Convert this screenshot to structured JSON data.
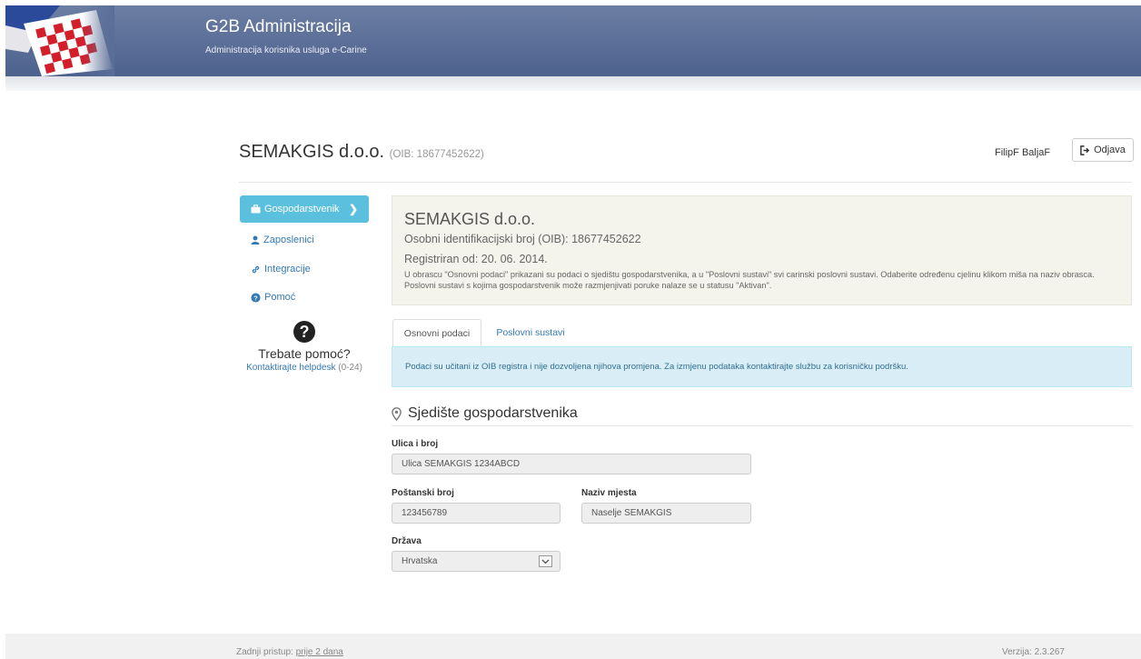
{
  "header": {
    "title": "G2B Administracija",
    "subtitle": "Administracija korisnika usluga e-Carine"
  },
  "topbar": {
    "company_name": "SEMAKGIS d.o.o.",
    "company_oib": "(OIB: 18677452622)",
    "user_name": "FilipF BaljaF",
    "logout_label": "Odjava"
  },
  "sidebar": {
    "items": [
      {
        "label": "Gospodarstvenik",
        "icon": "briefcase-icon",
        "active": true
      },
      {
        "label": "Zaposlenici",
        "icon": "user-icon",
        "active": false
      },
      {
        "label": "Integracije",
        "icon": "link-icon",
        "active": false
      },
      {
        "label": "Pomoć",
        "icon": "question-circle-icon",
        "active": false
      }
    ],
    "help": {
      "title": "Trebate pomoć?",
      "link": "Kontaktirajte helpdesk",
      "hours": "(0-24)"
    }
  },
  "info_panel": {
    "name": "SEMAKGIS d.o.o.",
    "oib": "Osobni identifikacijski broj (OIB): 18677452622",
    "registered": "Registriran od: 20. 06. 2014.",
    "description": "U obrascu \"Osnovni podaci\" prikazani su podaci o sjedištu gospodarstvenika, a u \"Poslovni sustavi\" svi carinski poslovni sustavi. Odaberite određenu cjelinu klikom miša na naziv obrasca. Poslovni sustavi s kojima gospodarstvenik može razmjenjivati poruke nalaze se u statusu \"Aktivan\"."
  },
  "tabs": [
    {
      "label": "Osnovni podaci",
      "active": true
    },
    {
      "label": "Poslovni sustavi",
      "active": false
    }
  ],
  "alert": "Podaci su učitani iz OIB registra i nije dozvoljena njihova promjena. Za izmjenu podataka kontaktirajte službu za korisničku podršku.",
  "address": {
    "heading": "Sjedište gospodarstvenika",
    "street_label": "Ulica i broj",
    "street_value": "Ulica SEMAKGIS 1234ABCD",
    "postal_label": "Poštanski broj",
    "postal_value": "123456789",
    "city_label": "Naziv mjesta",
    "city_value": "Naselje SEMAKGIS",
    "country_label": "Država",
    "country_value": "Hrvatska"
  },
  "footer": {
    "last_access_prefix": "Zadnji pristup:",
    "last_access_link": "prije 2 dana",
    "version": "Verzija: 2.3.267"
  },
  "colors": {
    "header": "#5a6e97",
    "active_nav": "#5bc0de",
    "link": "#337ab7",
    "alert_bg": "#d9edf7",
    "alert_text": "#31708f",
    "info_bg": "#f4f4ec"
  }
}
